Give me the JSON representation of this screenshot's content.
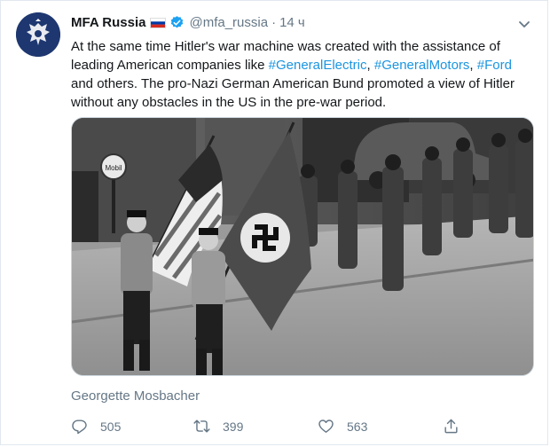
{
  "account": {
    "name": "MFA Russia",
    "handle": "@mfa_russia",
    "separator": "·",
    "time": "14 ч"
  },
  "tweet": {
    "text_1": "At the same time Hitler's war machine was created with the assistance of leading American companies like ",
    "hashtag_1": "#GeneralElectric",
    "text_2": ", ",
    "hashtag_2": "#GeneralMotors",
    "text_3": ", ",
    "hashtag_3": "#Ford",
    "text_4": " and others. The pro-Nazi German American Bund promoted a view of Hitler without any obstacles in the US in the pre-war period."
  },
  "media": {
    "caption": "Georgette Mosbacher",
    "sign_text": "Mobil"
  },
  "actions": {
    "replies": "505",
    "retweets": "399",
    "likes": "563"
  },
  "colors": {
    "link": "#1b95e0",
    "muted": "#657786",
    "verified": "#1da1f2",
    "avatar_bg": "#1e3770"
  },
  "icons": [
    "russia-flag-icon",
    "verified-badge-icon",
    "chevron-down-icon",
    "reply-icon",
    "retweet-icon",
    "like-icon",
    "share-icon"
  ]
}
